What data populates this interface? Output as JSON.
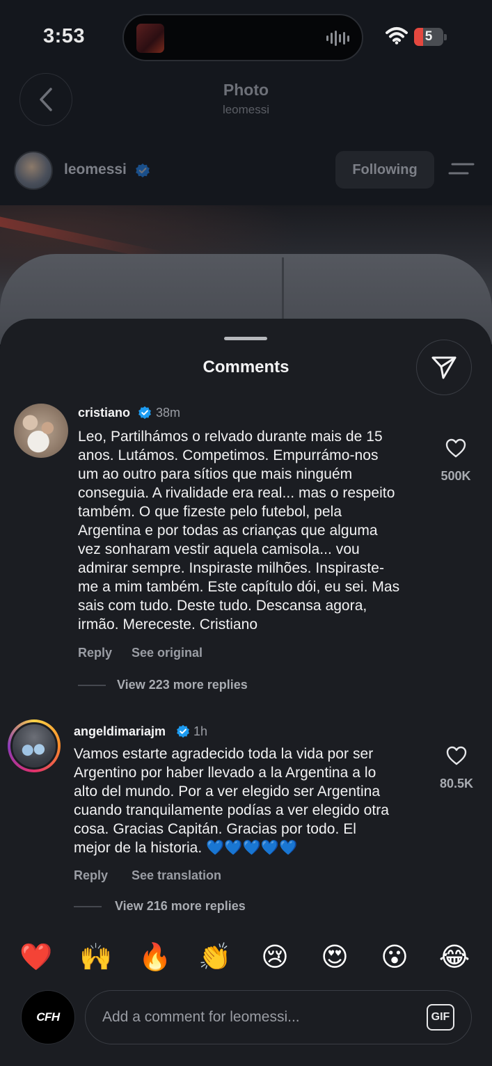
{
  "status_bar": {
    "time": "3:53",
    "battery_level": "5"
  },
  "header": {
    "title": "Photo",
    "subtitle": "leomessi"
  },
  "post_author": {
    "username": "leomessi",
    "follow_label": "Following"
  },
  "comments_sheet": {
    "title": "Comments"
  },
  "comments": [
    {
      "username": "cristiano",
      "time": "38m",
      "text": "Leo, Partilhámos o relvado durante mais de 15\nanos. Lutámos. Competimos. Empurrámo-nos\num ao outro para sítios que mais ninguém\nconseguia. A rivalidade era real... mas o respeito\ntambém. O que fizeste pelo futebol, pela\nArgentina e por todas as crianças que alguma\nvez sonharam vestir aquela camisola... vou\nadmirar sempre. Inspiraste milhões. Inspiraste-\nme a mim também. Este capítulo dói, eu sei. Mas\nsais com tudo. Deste tudo. Descansa agora,\nirmão. Mereceste. Cristiano",
      "likes": "500K",
      "reply_label": "Reply",
      "secondary_action": "See original",
      "view_replies": "View 223 more replies"
    },
    {
      "username": "angeldimariajm",
      "time": "1h",
      "text": "Vamos estarte agradecido toda la vida por ser\nArgentino por haber llevado a la Argentina a lo\nalto del mundo. Por a ver elegido ser Argentina\ncuando tranquilamente podías a ver elegido otra\ncosa. Gracias Capitán. Gracias por todo. El\nmejor de la historia. 💙💙💙💙💙",
      "likes": "80.5K",
      "reply_label": "Reply",
      "secondary_action": "See translation",
      "view_replies": "View 216 more replies"
    }
  ],
  "quick_reactions": [
    "❤️",
    "🙌",
    "🔥",
    "👏",
    "😢",
    "😍",
    "😮",
    "😂"
  ],
  "composer": {
    "avatar_text": "CFH",
    "placeholder": "Add a comment for leomessi...",
    "gif_label": "GIF"
  },
  "colors": {
    "verified": "#1d9bf0",
    "sheet_background": "#1b1d22",
    "background": "#14171d"
  }
}
